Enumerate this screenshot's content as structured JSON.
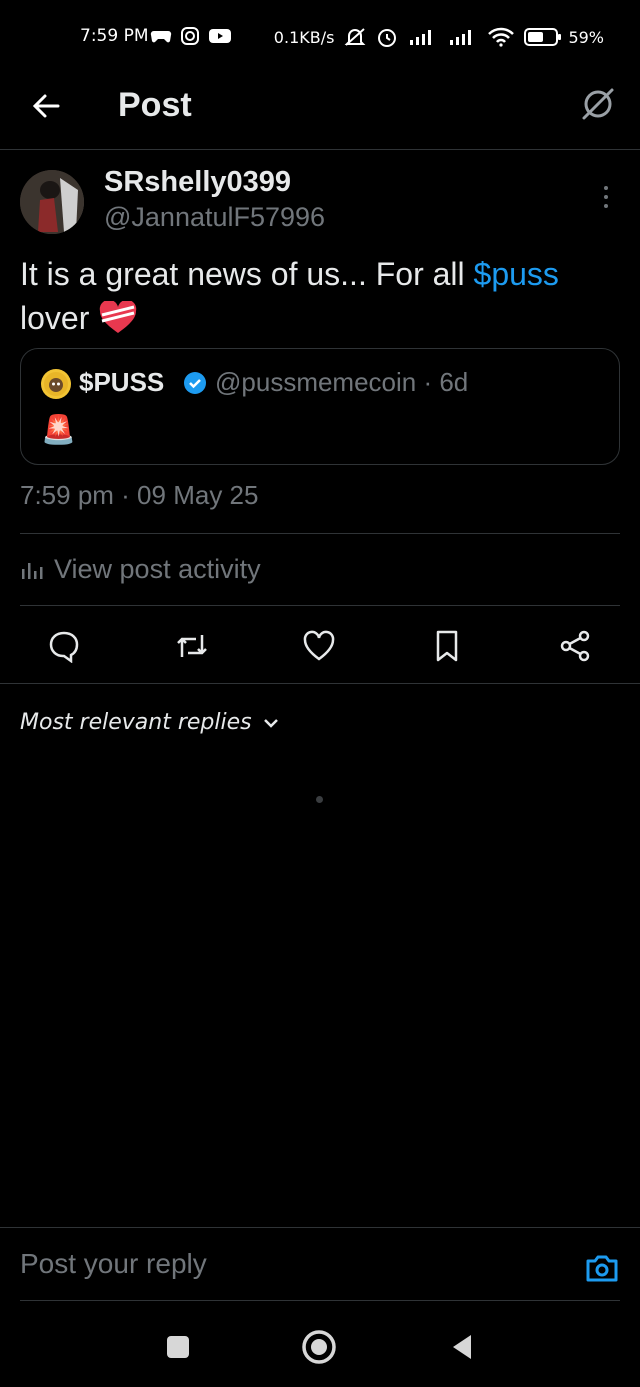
{
  "status_bar": {
    "time": "7:59 PM",
    "net_speed": "0.1KB/s",
    "battery": "59%",
    "battery_level": 0.59,
    "icons": [
      "gamepad-icon",
      "instagram-icon",
      "youtube-icon",
      "mute-icon",
      "alarm-icon",
      "signal-icon",
      "signal-icon",
      "wifi-icon",
      "battery-icon"
    ]
  },
  "header": {
    "title": "Post",
    "back_icon": "arrow-left-icon",
    "grok_icon": "grok-icon"
  },
  "post": {
    "display_name": "SRshelly0399",
    "handle": "@JannatulF57996",
    "text_before": "It is a great news of us... For all ",
    "cashtag": "$puss",
    "text_after": " lover",
    "emoji": "heart-with-ribbon",
    "timestamp": "7:59 pm · 09 May 25",
    "activity_label": "View post activity"
  },
  "quote": {
    "name": "$PUSS",
    "meta": "@pussmemecoin · 6d",
    "text": "🚨"
  },
  "actions": [
    "reply-icon",
    "repost-icon",
    "like-icon",
    "bookmark-icon",
    "share-icon"
  ],
  "replies": {
    "sort_label": "Most relevant replies"
  },
  "reply_bar": {
    "placeholder": "Post your reply"
  },
  "colors": {
    "accent": "#1d9bf0",
    "background": "#000000",
    "muted": "#71767b",
    "border": "#2f3336"
  }
}
